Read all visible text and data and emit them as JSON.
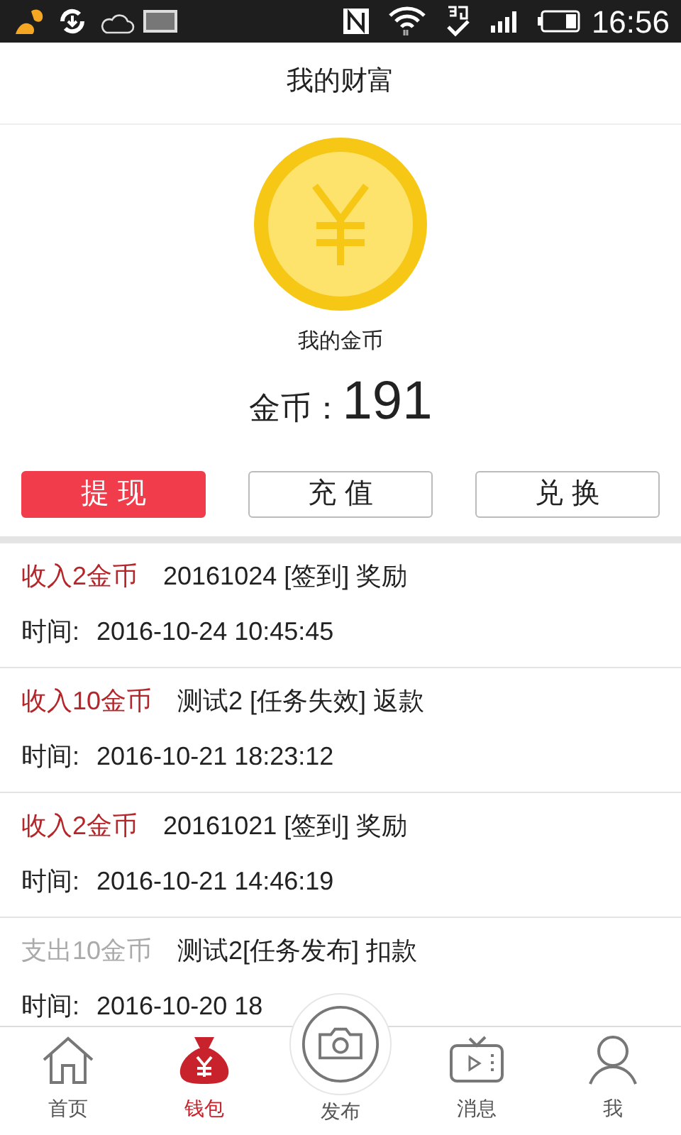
{
  "status_bar": {
    "time": "16:56"
  },
  "header": {
    "title": "我的财富"
  },
  "wallet": {
    "caption": "我的金币",
    "balance_label": "金币：",
    "balance": "191"
  },
  "actions": [
    {
      "label": "提 现",
      "selected": true
    },
    {
      "label": "充 值",
      "selected": false
    },
    {
      "label": "兑 换",
      "selected": false
    }
  ],
  "transactions": [
    {
      "kind": "income",
      "amount": "收入2金币",
      "description": "20161024 [签到] 奖励",
      "time_label": "时间:",
      "time": "2016-10-24 10:45:45"
    },
    {
      "kind": "income",
      "amount": "收入10金币",
      "description": "测试2 [任务失效] 返款",
      "time_label": "时间:",
      "time": "2016-10-21 18:23:12"
    },
    {
      "kind": "income",
      "amount": "收入2金币",
      "description": "20161021 [签到] 奖励",
      "time_label": "时间:",
      "time": "2016-10-21 14:46:19"
    },
    {
      "kind": "expense",
      "amount": "支出10金币",
      "description": "测试2[任务发布] 扣款",
      "time_label": "时间:",
      "time": "2016-10-20 18"
    }
  ],
  "bottom_nav": [
    {
      "kind": "home",
      "label": "首页",
      "selected": false
    },
    {
      "kind": "wallet",
      "label": "钱包",
      "selected": true
    },
    {
      "kind": "camera",
      "label": "发布",
      "selected": false
    },
    {
      "kind": "tv",
      "label": "消息",
      "selected": false
    },
    {
      "kind": "person",
      "label": "我",
      "selected": false
    }
  ]
}
